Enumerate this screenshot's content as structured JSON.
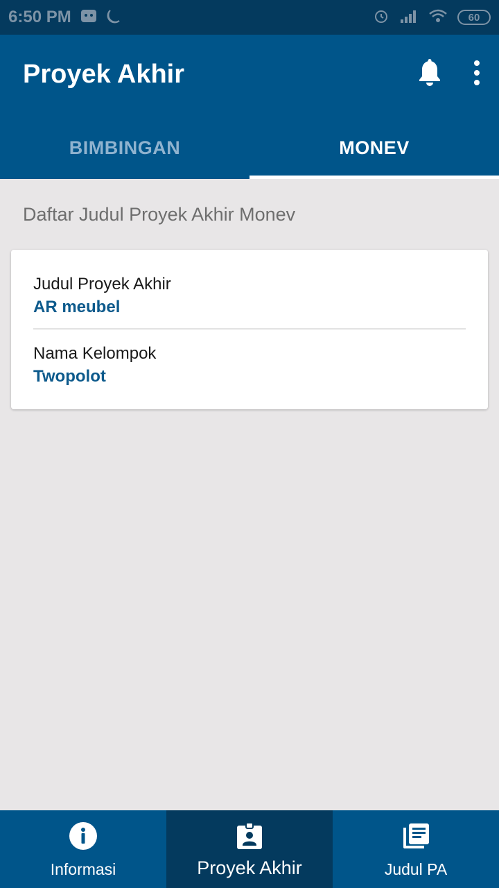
{
  "status_bar": {
    "time": "6:50 PM",
    "battery": "60",
    "icons": [
      "notification-icon",
      "moon-icon",
      "alarm-icon",
      "signal-icon",
      "wifi-icon",
      "battery-icon"
    ]
  },
  "app_bar": {
    "title": "Proyek Akhir",
    "actions": [
      "bell-icon",
      "more-vert-icon"
    ]
  },
  "tabs": [
    {
      "label": "BIMBINGAN",
      "active": false
    },
    {
      "label": "MONEV",
      "active": true
    }
  ],
  "main": {
    "section_title": "Daftar Judul Proyek Akhir Monev",
    "card": {
      "rows": [
        {
          "label": "Judul Proyek Akhir",
          "value": "AR meubel"
        },
        {
          "label": "Nama Kelompok",
          "value": "Twopolot"
        }
      ]
    }
  },
  "bottom_nav": {
    "items": [
      {
        "label": "Informasi",
        "icon": "info-icon",
        "active": false
      },
      {
        "label": "Proyek Akhir",
        "icon": "badge-icon",
        "active": true
      },
      {
        "label": "Judul PA",
        "icon": "library-books-icon",
        "active": false
      }
    ]
  },
  "colors": {
    "primary": "#00558a",
    "primary_dark": "#043a5e",
    "accent_text": "#0d5a8c",
    "background": "#e8e6e7"
  }
}
